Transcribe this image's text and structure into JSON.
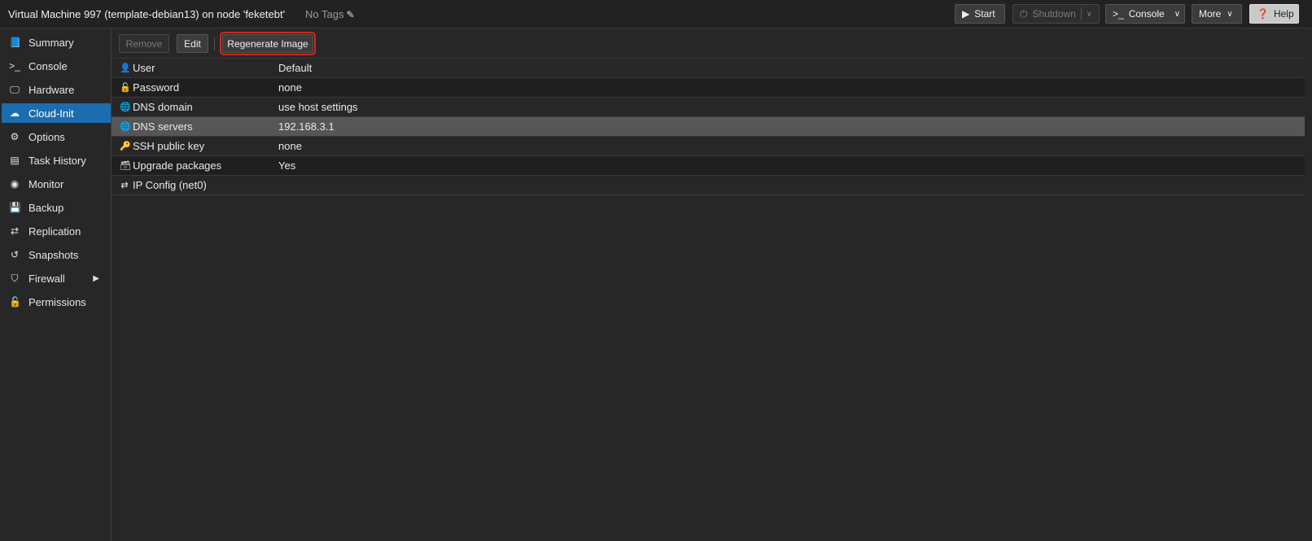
{
  "header": {
    "title": "Virtual Machine 997 (template-debian13) on node 'feketebt'",
    "tags": "No Tags",
    "buttons": {
      "start": "Start",
      "shutdown": "Shutdown",
      "console": "Console",
      "more": "More",
      "help": "Help"
    }
  },
  "sidebar": {
    "items": [
      {
        "label": "Summary",
        "icon": "book-icon"
      },
      {
        "label": "Console",
        "icon": "terminal-icon"
      },
      {
        "label": "Hardware",
        "icon": "desktop-icon"
      },
      {
        "label": "Cloud-Init",
        "icon": "cloud-icon",
        "active": true
      },
      {
        "label": "Options",
        "icon": "gear-icon"
      },
      {
        "label": "Task History",
        "icon": "list-icon"
      },
      {
        "label": "Monitor",
        "icon": "eye-icon"
      },
      {
        "label": "Backup",
        "icon": "floppy-icon"
      },
      {
        "label": "Replication",
        "icon": "retweet-icon"
      },
      {
        "label": "Snapshots",
        "icon": "history-icon"
      },
      {
        "label": "Firewall",
        "icon": "shield-icon"
      },
      {
        "label": "Permissions",
        "icon": "unlock-icon"
      }
    ]
  },
  "toolbar": {
    "remove": "Remove",
    "edit": "Edit",
    "regenerate": "Regenerate Image"
  },
  "rows": [
    {
      "key": "User",
      "value": "Default",
      "icon": "user-icon"
    },
    {
      "key": "Password",
      "value": "none",
      "icon": "unlock-icon"
    },
    {
      "key": "DNS domain",
      "value": "use host settings",
      "icon": "globe-icon"
    },
    {
      "key": "DNS servers",
      "value": "192.168.3.1",
      "icon": "globe-icon",
      "selected": true
    },
    {
      "key": "SSH public key",
      "value": "none",
      "icon": "key-icon"
    },
    {
      "key": "Upgrade packages",
      "value": "Yes",
      "icon": "archive-icon"
    },
    {
      "key": "IP Config (net0)",
      "value": "",
      "icon": "exchange-icon"
    }
  ],
  "colors": {
    "accent": "#1c6db0",
    "highlight_border": "#d0281b",
    "selected_row": "#565656"
  }
}
